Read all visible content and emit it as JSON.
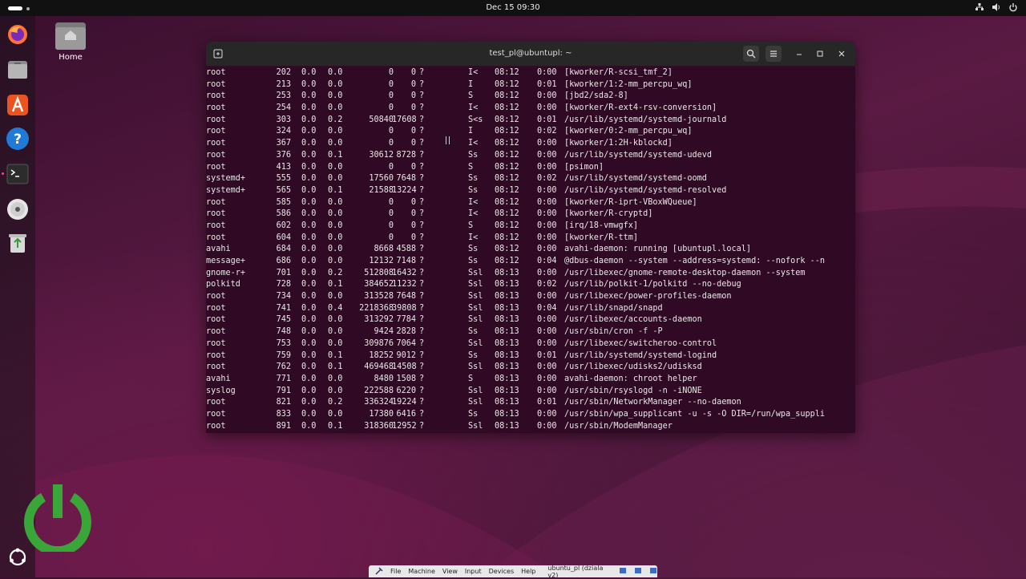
{
  "topbar": {
    "clock": "Dec 15  09:30"
  },
  "desktop": {
    "home_label": "Home"
  },
  "window": {
    "title": "test_pl@ubuntupl: ~"
  },
  "processes": [
    {
      "user": "root",
      "pid": "202",
      "cpu": "0.0",
      "mem": "0.0",
      "vsz": "0",
      "rss": "0",
      "tty": "?",
      "stat": "I<",
      "start": "08:12",
      "time": "0:00",
      "cmd": "[kworker/R-scsi_tmf_2]"
    },
    {
      "user": "root",
      "pid": "213",
      "cpu": "0.0",
      "mem": "0.0",
      "vsz": "0",
      "rss": "0",
      "tty": "?",
      "stat": "I",
      "start": "08:12",
      "time": "0:01",
      "cmd": "[kworker/1:2-mm_percpu_wq]"
    },
    {
      "user": "root",
      "pid": "253",
      "cpu": "0.0",
      "mem": "0.0",
      "vsz": "0",
      "rss": "0",
      "tty": "?",
      "stat": "S",
      "start": "08:12",
      "time": "0:00",
      "cmd": "[jbd2/sda2-8]"
    },
    {
      "user": "root",
      "pid": "254",
      "cpu": "0.0",
      "mem": "0.0",
      "vsz": "0",
      "rss": "0",
      "tty": "?",
      "stat": "I<",
      "start": "08:12",
      "time": "0:00",
      "cmd": "[kworker/R-ext4-rsv-conversion]"
    },
    {
      "user": "root",
      "pid": "303",
      "cpu": "0.0",
      "mem": "0.2",
      "vsz": "50840",
      "rss": "17608",
      "tty": "?",
      "stat": "S<s",
      "start": "08:12",
      "time": "0:01",
      "cmd": "/usr/lib/systemd/systemd-journald"
    },
    {
      "user": "root",
      "pid": "324",
      "cpu": "0.0",
      "mem": "0.0",
      "vsz": "0",
      "rss": "0",
      "tty": "?",
      "stat": "I",
      "start": "08:12",
      "time": "0:02",
      "cmd": "[kworker/0:2-mm_percpu_wq]"
    },
    {
      "user": "root",
      "pid": "367",
      "cpu": "0.0",
      "mem": "0.0",
      "vsz": "0",
      "rss": "0",
      "tty": "?",
      "stat": "I<",
      "start": "08:12",
      "time": "0:00",
      "cmd": "[kworker/1:2H-kblockd]"
    },
    {
      "user": "root",
      "pid": "376",
      "cpu": "0.0",
      "mem": "0.1",
      "vsz": "30612",
      "rss": "8728",
      "tty": "?",
      "stat": "Ss",
      "start": "08:12",
      "time": "0:00",
      "cmd": "/usr/lib/systemd/systemd-udevd"
    },
    {
      "user": "root",
      "pid": "413",
      "cpu": "0.0",
      "mem": "0.0",
      "vsz": "0",
      "rss": "0",
      "tty": "?",
      "stat": "S",
      "start": "08:12",
      "time": "0:00",
      "cmd": "[psimon]"
    },
    {
      "user": "systemd+",
      "pid": "555",
      "cpu": "0.0",
      "mem": "0.0",
      "vsz": "17560",
      "rss": "7648",
      "tty": "?",
      "stat": "Ss",
      "start": "08:12",
      "time": "0:02",
      "cmd": "/usr/lib/systemd/systemd-oomd"
    },
    {
      "user": "systemd+",
      "pid": "565",
      "cpu": "0.0",
      "mem": "0.1",
      "vsz": "21588",
      "rss": "13224",
      "tty": "?",
      "stat": "Ss",
      "start": "08:12",
      "time": "0:00",
      "cmd": "/usr/lib/systemd/systemd-resolved"
    },
    {
      "user": "root",
      "pid": "585",
      "cpu": "0.0",
      "mem": "0.0",
      "vsz": "0",
      "rss": "0",
      "tty": "?",
      "stat": "I<",
      "start": "08:12",
      "time": "0:00",
      "cmd": "[kworker/R-iprt-VBoxWQueue]"
    },
    {
      "user": "root",
      "pid": "586",
      "cpu": "0.0",
      "mem": "0.0",
      "vsz": "0",
      "rss": "0",
      "tty": "?",
      "stat": "I<",
      "start": "08:12",
      "time": "0:00",
      "cmd": "[kworker/R-cryptd]"
    },
    {
      "user": "root",
      "pid": "602",
      "cpu": "0.0",
      "mem": "0.0",
      "vsz": "0",
      "rss": "0",
      "tty": "?",
      "stat": "S",
      "start": "08:12",
      "time": "0:00",
      "cmd": "[irq/18-vmwgfx]"
    },
    {
      "user": "root",
      "pid": "604",
      "cpu": "0.0",
      "mem": "0.0",
      "vsz": "0",
      "rss": "0",
      "tty": "?",
      "stat": "I<",
      "start": "08:12",
      "time": "0:00",
      "cmd": "[kworker/R-ttm]"
    },
    {
      "user": "avahi",
      "pid": "684",
      "cpu": "0.0",
      "mem": "0.0",
      "vsz": "8668",
      "rss": "4588",
      "tty": "?",
      "stat": "Ss",
      "start": "08:12",
      "time": "0:00",
      "cmd": "avahi-daemon: running [ubuntupl.local]"
    },
    {
      "user": "message+",
      "pid": "686",
      "cpu": "0.0",
      "mem": "0.0",
      "vsz": "12132",
      "rss": "7148",
      "tty": "?",
      "stat": "Ss",
      "start": "08:12",
      "time": "0:04",
      "cmd": "@dbus-daemon --system --address=systemd: --nofork --n"
    },
    {
      "user": "gnome-r+",
      "pid": "701",
      "cpu": "0.0",
      "mem": "0.2",
      "vsz": "512808",
      "rss": "16432",
      "tty": "?",
      "stat": "Ssl",
      "start": "08:13",
      "time": "0:00",
      "cmd": "/usr/libexec/gnome-remote-desktop-daemon --system"
    },
    {
      "user": "polkitd",
      "pid": "728",
      "cpu": "0.0",
      "mem": "0.1",
      "vsz": "384652",
      "rss": "11232",
      "tty": "?",
      "stat": "Ssl",
      "start": "08:13",
      "time": "0:02",
      "cmd": "/usr/lib/polkit-1/polkitd --no-debug"
    },
    {
      "user": "root",
      "pid": "734",
      "cpu": "0.0",
      "mem": "0.0",
      "vsz": "313528",
      "rss": "7648",
      "tty": "?",
      "stat": "Ssl",
      "start": "08:13",
      "time": "0:00",
      "cmd": "/usr/libexec/power-profiles-daemon"
    },
    {
      "user": "root",
      "pid": "741",
      "cpu": "0.0",
      "mem": "0.4",
      "vsz": "2218368",
      "rss": "39808",
      "tty": "?",
      "stat": "Ssl",
      "start": "08:13",
      "time": "0:04",
      "cmd": "/usr/lib/snapd/snapd"
    },
    {
      "user": "root",
      "pid": "745",
      "cpu": "0.0",
      "mem": "0.0",
      "vsz": "313292",
      "rss": "7784",
      "tty": "?",
      "stat": "Ssl",
      "start": "08:13",
      "time": "0:00",
      "cmd": "/usr/libexec/accounts-daemon"
    },
    {
      "user": "root",
      "pid": "748",
      "cpu": "0.0",
      "mem": "0.0",
      "vsz": "9424",
      "rss": "2828",
      "tty": "?",
      "stat": "Ss",
      "start": "08:13",
      "time": "0:00",
      "cmd": "/usr/sbin/cron -f -P"
    },
    {
      "user": "root",
      "pid": "753",
      "cpu": "0.0",
      "mem": "0.0",
      "vsz": "309876",
      "rss": "7064",
      "tty": "?",
      "stat": "Ssl",
      "start": "08:13",
      "time": "0:00",
      "cmd": "/usr/libexec/switcheroo-control"
    },
    {
      "user": "root",
      "pid": "759",
      "cpu": "0.0",
      "mem": "0.1",
      "vsz": "18252",
      "rss": "9012",
      "tty": "?",
      "stat": "Ss",
      "start": "08:13",
      "time": "0:01",
      "cmd": "/usr/lib/systemd/systemd-logind"
    },
    {
      "user": "root",
      "pid": "762",
      "cpu": "0.0",
      "mem": "0.1",
      "vsz": "469468",
      "rss": "14508",
      "tty": "?",
      "stat": "Ssl",
      "start": "08:13",
      "time": "0:00",
      "cmd": "/usr/libexec/udisks2/udisksd"
    },
    {
      "user": "avahi",
      "pid": "771",
      "cpu": "0.0",
      "mem": "0.0",
      "vsz": "8480",
      "rss": "1508",
      "tty": "?",
      "stat": "S",
      "start": "08:13",
      "time": "0:00",
      "cmd": "avahi-daemon: chroot helper"
    },
    {
      "user": "syslog",
      "pid": "791",
      "cpu": "0.0",
      "mem": "0.0",
      "vsz": "222588",
      "rss": "6220",
      "tty": "?",
      "stat": "Ssl",
      "start": "08:13",
      "time": "0:00",
      "cmd": "/usr/sbin/rsyslogd -n -iNONE"
    },
    {
      "user": "root",
      "pid": "821",
      "cpu": "0.0",
      "mem": "0.2",
      "vsz": "336324",
      "rss": "19224",
      "tty": "?",
      "stat": "Ssl",
      "start": "08:13",
      "time": "0:01",
      "cmd": "/usr/sbin/NetworkManager --no-daemon"
    },
    {
      "user": "root",
      "pid": "833",
      "cpu": "0.0",
      "mem": "0.0",
      "vsz": "17380",
      "rss": "6416",
      "tty": "?",
      "stat": "Ss",
      "start": "08:13",
      "time": "0:00",
      "cmd": "/usr/sbin/wpa_supplicant -u -s -O DIR=/run/wpa_suppli"
    },
    {
      "user": "root",
      "pid": "891",
      "cpu": "0.0",
      "mem": "0.1",
      "vsz": "318360",
      "rss": "12952",
      "tty": "?",
      "stat": "Ssl",
      "start": "08:13",
      "time": "0:00",
      "cmd": "/usr/sbin/ModemManager"
    }
  ],
  "taskbar": {
    "items": [
      "File",
      "Machine",
      "View",
      "Input",
      "Devices",
      "Help"
    ],
    "vm_name": "ubuntu_pl (dziala v2)"
  },
  "colors": {
    "terminal_bg": "#300a24",
    "accent": "#e95420",
    "power": "#3aa63a"
  }
}
